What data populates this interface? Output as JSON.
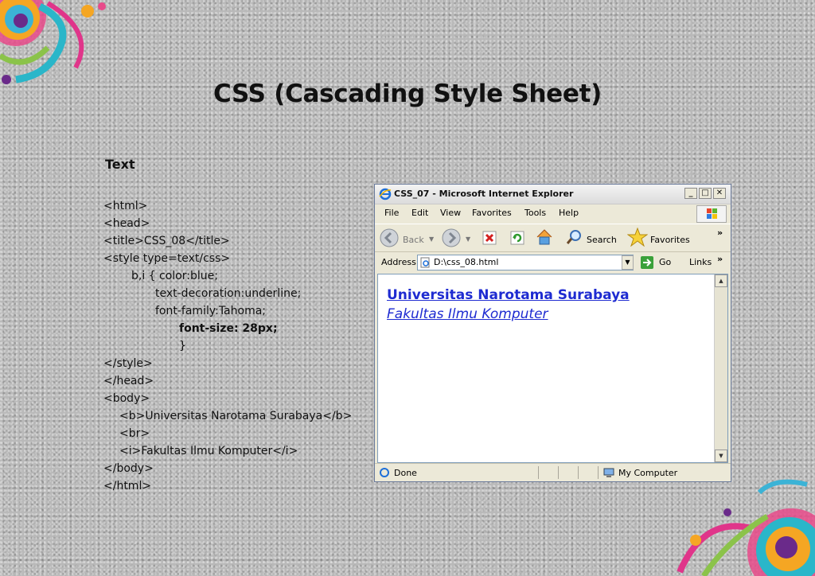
{
  "slide": {
    "title": "CSS (Cascading Style Sheet)",
    "section_label": "Text",
    "code_lines": [
      {
        "text": "<html>",
        "indent": "",
        "bold": false
      },
      {
        "text": "<head>",
        "indent": "",
        "bold": false
      },
      {
        "text": "<title>CSS_08</title>",
        "indent": "",
        "bold": false
      },
      {
        "text": "<style type=text/css>",
        "indent": "",
        "bold": false
      },
      {
        "text": "b,i { color:blue;",
        "indent": "       ",
        "bold": false
      },
      {
        "text": "text-decoration:underline;",
        "indent": "             ",
        "bold": false
      },
      {
        "text": "font-family:Tahoma;",
        "indent": "             ",
        "bold": false
      },
      {
        "text": "font-size: 28px;",
        "indent": "                   ",
        "bold": true
      },
      {
        "text": "}",
        "indent": "                   ",
        "bold": false
      },
      {
        "text": "</style>",
        "indent": "",
        "bold": false
      },
      {
        "text": "</head>",
        "indent": "",
        "bold": false
      },
      {
        "text": "<body>",
        "indent": "",
        "bold": false
      },
      {
        "text": "<b>Universitas Narotama Surabaya</b>",
        "indent": "    ",
        "bold": false
      },
      {
        "text": "<br>",
        "indent": "    ",
        "bold": false
      },
      {
        "text": "<i>Fakultas Ilmu Komputer</i>",
        "indent": "    ",
        "bold": false
      },
      {
        "text": "</body>",
        "indent": "",
        "bold": false
      },
      {
        "text": "</html>",
        "indent": "",
        "bold": false
      }
    ]
  },
  "browser": {
    "title": "CSS_07 - Microsoft Internet Explorer",
    "window_buttons": {
      "minimize": "_",
      "maximize": "□",
      "close": "✕"
    },
    "menu": [
      "File",
      "Edit",
      "View",
      "Favorites",
      "Tools",
      "Help"
    ],
    "toolbar": {
      "back": "Back",
      "search": "Search",
      "favorites": "Favorites",
      "more": "»"
    },
    "address": {
      "label": "Address",
      "value": "D:\\css_08.html",
      "go": "Go",
      "links": "Links",
      "more": "»"
    },
    "content": {
      "line1": "Universitas Narotama Surabaya",
      "line2": "Fakultas Ilmu Komputer"
    },
    "status": {
      "text": "Done",
      "zone": "My Computer"
    }
  },
  "colors": {
    "link_blue": "#1e2bd1",
    "title_bar": "#e6e6e6"
  },
  "icons": [
    "ie-logo-icon",
    "back-icon",
    "forward-icon",
    "stop-icon",
    "refresh-icon",
    "home-icon",
    "search-icon",
    "favorites-star-icon",
    "go-arrow-icon",
    "computer-icon",
    "windows-flag-icon"
  ]
}
